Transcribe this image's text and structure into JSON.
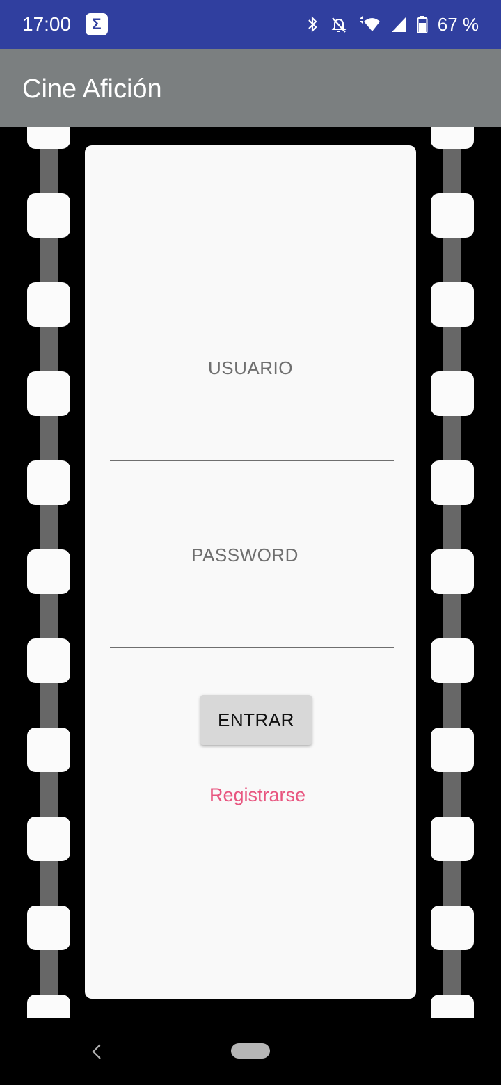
{
  "status_bar": {
    "time": "17:00",
    "notification_icon": "sigma-icon",
    "notification_glyph": "Σ",
    "icons": [
      "bluetooth-icon",
      "notifications-off-icon",
      "wifi-icon",
      "signal-icon",
      "battery-icon"
    ],
    "battery_text": "67 %"
  },
  "app_bar": {
    "title": "Cine Afición"
  },
  "form": {
    "username_label": "USUARIO",
    "username_value": "",
    "password_label": "PASSWORD",
    "password_value": "",
    "enter_button": "ENTRAR",
    "register_link": "Registrarse"
  },
  "nav_bar": {
    "icons": [
      "back-icon",
      "home-pill"
    ]
  },
  "colors": {
    "status_bar": "#303f9f",
    "app_bar": "#7b7f80",
    "film": "#000000",
    "frame": "#f9f9f9",
    "accent_link": "#e8557f",
    "button": "#d8d8d8"
  }
}
